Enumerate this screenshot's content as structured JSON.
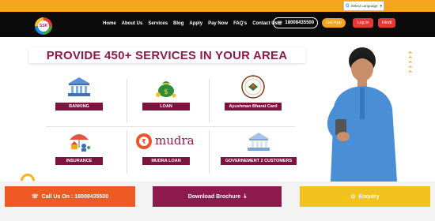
{
  "language_select": {
    "google_mark": "G",
    "label": "Select Language"
  },
  "logo": {
    "text": "SSK"
  },
  "nav": {
    "items": [
      "Home",
      "About Us",
      "Services",
      "Blog",
      "Apply",
      "Pay Now",
      "FAQ's",
      "Contact Us"
    ]
  },
  "header_actions": {
    "phone": "18008435500",
    "get_app": "Get App",
    "login": "Log in",
    "hindi": "Hindi"
  },
  "hero": {
    "headline": "PROVIDE 450+ SERVICES IN YOUR AREA"
  },
  "services": [
    {
      "label": "BANKING",
      "icon": "bank-icon"
    },
    {
      "label": "LOAN",
      "icon": "money-bag-icon"
    },
    {
      "label": "Ayushman Bharat Card",
      "icon": "ayushman-logo-icon"
    },
    {
      "label": "INSURANCE",
      "icon": "insurance-icon"
    },
    {
      "label": "MUDRA LOAN",
      "icon": "mudra-logo-icon"
    },
    {
      "label": "GOVERNEMENT 2 CUSTOMERS",
      "icon": "government-building-icon"
    }
  ],
  "mudra_logo_text": "mudra",
  "cta": {
    "call": "Call Us On : 18008435500",
    "brochure": "Download Brochure",
    "enquiry": "Enquiry"
  },
  "colors": {
    "accent_orange": "#f4a41e",
    "brand_maroon": "#8e1a4e",
    "nav_black": "#0b0b0b",
    "button_red": "#e53935",
    "cta_orange": "#ee5a24",
    "cta_yellow": "#f4c21e"
  }
}
